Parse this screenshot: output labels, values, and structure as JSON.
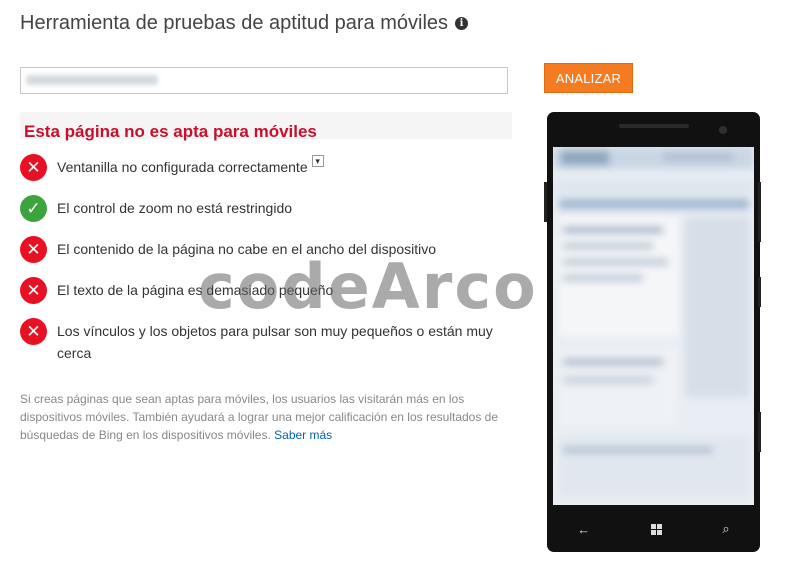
{
  "header": {
    "title": "Herramienta de pruebas de aptitud para móviles",
    "info_icon": "i"
  },
  "search": {
    "url_value": "",
    "analyze_label": "ANALIZAR"
  },
  "result": {
    "title": "Esta página no es apta para móviles",
    "checks": [
      {
        "status": "fail",
        "label": "Ventanilla no configurada correctamente",
        "expandable": true
      },
      {
        "status": "pass",
        "label": "El control de zoom no está restringido"
      },
      {
        "status": "fail",
        "label": "El contenido de la página no cabe en el ancho del dispositivo"
      },
      {
        "status": "fail",
        "label": "El texto de la página es demasiado pequeño"
      },
      {
        "status": "fail",
        "label": "Los vínculos y los objetos para pulsar son muy pequeños o están muy cerca"
      }
    ]
  },
  "note": {
    "text": "Si creas páginas que sean aptas para móviles, los usuarios las visitarán más en los dispositivos móviles. También ayudará a lograr una mejor calificación en los resultados de búsquedas de Bing en los dispositivos móviles.",
    "link_label": "Saber más"
  },
  "phone": {
    "nav": {
      "back": "←",
      "search": "⌕"
    }
  },
  "watermark": "codeArco",
  "colors": {
    "accent": "#f47b20",
    "fail_title": "#c8102e",
    "fail": "#e81123",
    "pass": "#3ca43c",
    "link": "#0063b1"
  }
}
